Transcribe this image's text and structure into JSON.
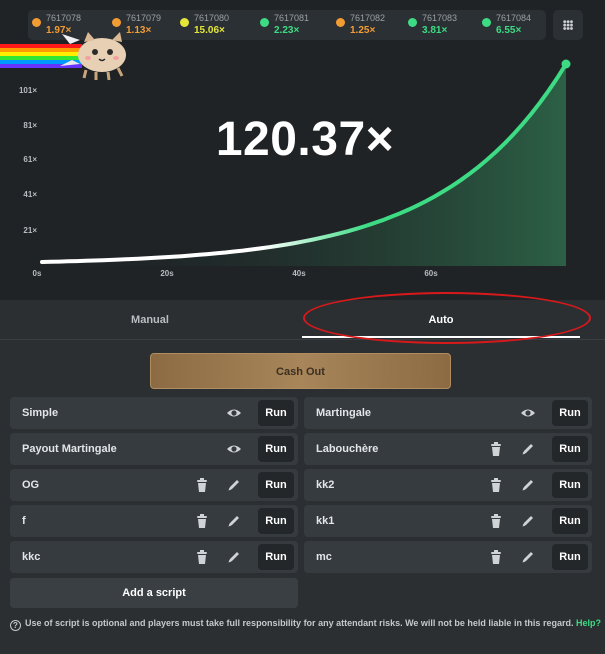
{
  "history": [
    {
      "id": "7617078",
      "mult": "1.97×",
      "color": "#f39c33"
    },
    {
      "id": "7617079",
      "mult": "1.13×",
      "color": "#f39c33"
    },
    {
      "id": "7617080",
      "mult": "15.06×",
      "color": "#e4e63a"
    },
    {
      "id": "7617081",
      "mult": "2.23×",
      "color": "#3ddc84"
    },
    {
      "id": "7617082",
      "mult": "1.25×",
      "color": "#f39c33"
    },
    {
      "id": "7617083",
      "mult": "3.81×",
      "color": "#3ddc84"
    },
    {
      "id": "7617084",
      "mult": "6.55×",
      "color": "#3ddc84"
    }
  ],
  "graph": {
    "current_multiplier": "120.37×",
    "y_ticks": [
      "101×",
      "81×",
      "61×",
      "41×",
      "21×"
    ],
    "x_ticks": [
      "0s",
      "20s",
      "40s",
      "60s"
    ],
    "line_color": "#3ddc84"
  },
  "tabs": {
    "manual": "Manual",
    "auto": "Auto"
  },
  "cashout_label": "Cash Out",
  "scripts_left": [
    {
      "name": "Simple",
      "icons": [
        "eye-icon"
      ]
    },
    {
      "name": "Payout Martingale",
      "icons": [
        "eye-icon"
      ]
    },
    {
      "name": "OG",
      "icons": [
        "trash-icon",
        "pencil-icon"
      ]
    },
    {
      "name": "f",
      "icons": [
        "trash-icon",
        "pencil-icon"
      ]
    },
    {
      "name": "kkc",
      "icons": [
        "trash-icon",
        "pencil-icon"
      ]
    }
  ],
  "scripts_right": [
    {
      "name": "Martingale",
      "icons": [
        "eye-icon"
      ]
    },
    {
      "name": "Labouchère",
      "icons": [
        "trash-icon",
        "pencil-icon"
      ]
    },
    {
      "name": "kk2",
      "icons": [
        "trash-icon",
        "pencil-icon"
      ]
    },
    {
      "name": "kk1",
      "icons": [
        "trash-icon",
        "pencil-icon"
      ]
    },
    {
      "name": "mc",
      "icons": [
        "trash-icon",
        "pencil-icon"
      ]
    }
  ],
  "run_label": "Run",
  "add_script_label": "Add a script",
  "disclaimer": {
    "text": "Use of script is optional and players must take full responsibility for any attendant risks. We will not be held liable in this regard.",
    "help_link": "Help?"
  }
}
